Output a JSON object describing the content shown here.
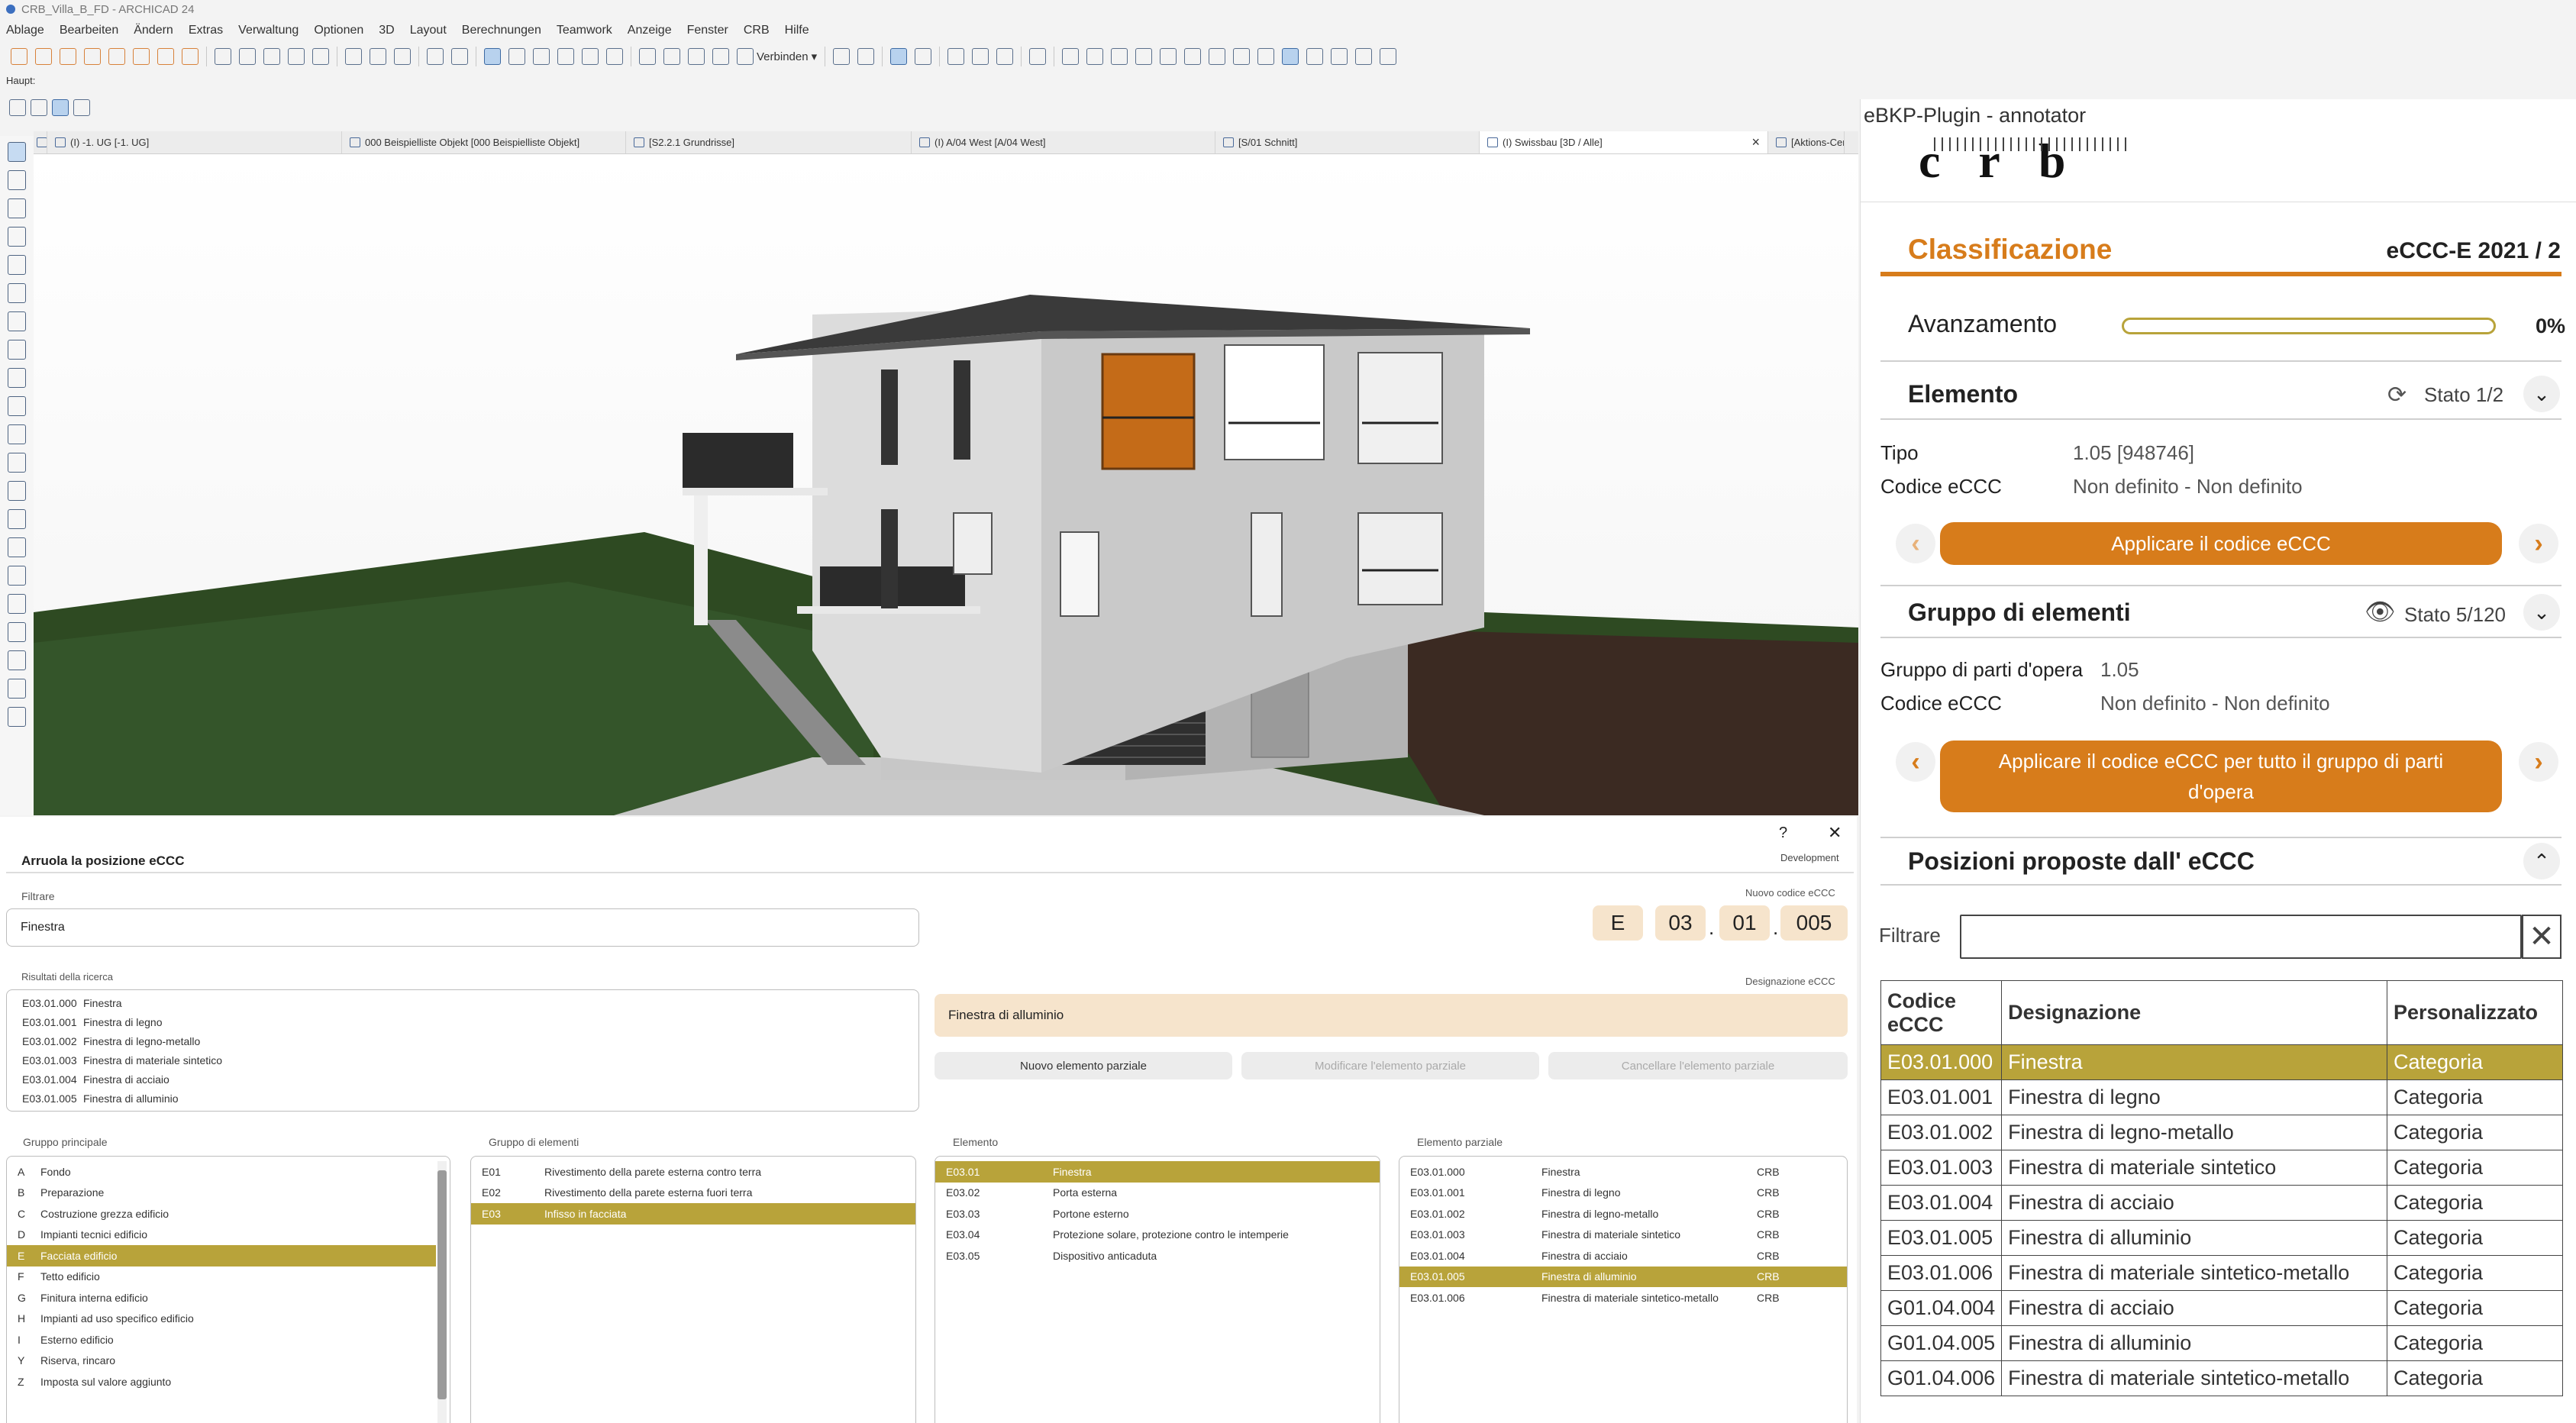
{
  "window": {
    "title": "CRB_Villa_B_FD - ARCHICAD 24"
  },
  "menu": [
    "Ablage",
    "Bearbeiten",
    "Ändern",
    "Extras",
    "Verwaltung",
    "Optionen",
    "3D",
    "Layout",
    "Berechnungen",
    "Teamwork",
    "Anzeige",
    "Fenster",
    "CRB",
    "Hilfe"
  ],
  "toolbar": {
    "connect_label": "Verbinden",
    "haupt_label": "Haupt:"
  },
  "tabs": [
    {
      "label": "(I) -1. UG [-1. UG]"
    },
    {
      "label": "000 Beispielliste Objekt [000 Beispielliste Objekt]"
    },
    {
      "label": "[S2.2.1 Grundrisse]"
    },
    {
      "label": "(I) A/04 West [A/04 West]"
    },
    {
      "label": "[S/01 Schnitt]"
    },
    {
      "label": "(I) Swissbau [3D / Alle]"
    },
    {
      "label": "[Aktions-Cen"
    }
  ],
  "colors": {
    "accent": "#d77c1b",
    "selection": "#b8a33a"
  },
  "position_panel": {
    "title": "Arruola la posizione eCCC",
    "help": "?",
    "close": "✕",
    "development": "Development",
    "filter_label": "Filtrare",
    "filter_value": "Finestra",
    "new_code_label": "Nuovo codice eCCC",
    "code_parts": [
      "E",
      "03",
      "01",
      "005"
    ],
    "code_dot": ".",
    "results_label": "Risultati della ricerca",
    "results": [
      {
        "code": "E03.01.000",
        "name": "Finestra"
      },
      {
        "code": "E03.01.001",
        "name": "Finestra di legno"
      },
      {
        "code": "E03.01.002",
        "name": "Finestra di legno-metallo"
      },
      {
        "code": "E03.01.003",
        "name": "Finestra di materiale sintetico"
      },
      {
        "code": "E03.01.004",
        "name": "Finestra di acciaio"
      },
      {
        "code": "E03.01.005",
        "name": "Finestra di alluminio"
      }
    ],
    "designation_label": "Designazione eCCC",
    "designation_value": "Finestra di alluminio",
    "buttons": {
      "new": "Nuovo elemento parziale",
      "modify": "Modificare l'elemento parziale",
      "delete": "Cancellare l'elemento parziale"
    },
    "main_group_label": "Gruppo principale",
    "main_groups": [
      {
        "code": "A",
        "name": "Fondo"
      },
      {
        "code": "B",
        "name": "Preparazione"
      },
      {
        "code": "C",
        "name": "Costruzione grezza edificio"
      },
      {
        "code": "D",
        "name": "Impianti tecnici edificio"
      },
      {
        "code": "E",
        "name": "Facciata edificio",
        "selected": true
      },
      {
        "code": "F",
        "name": "Tetto edificio"
      },
      {
        "code": "G",
        "name": "Finitura interna edificio"
      },
      {
        "code": "H",
        "name": "Impianti ad uso specifico edificio"
      },
      {
        "code": "I",
        "name": "Esterno edificio"
      },
      {
        "code": "Y",
        "name": "Riserva, rincaro"
      },
      {
        "code": "Z",
        "name": "Imposta sul valore aggiunto"
      }
    ],
    "element_group_label": "Gruppo di elementi",
    "element_groups": [
      {
        "code": "E01",
        "name": "Rivestimento della parete esterna contro terra"
      },
      {
        "code": "E02",
        "name": "Rivestimento della parete esterna fuori terra"
      },
      {
        "code": "E03",
        "name": "Infisso in facciata",
        "selected": true
      }
    ],
    "element_label": "Elemento",
    "elements": [
      {
        "code": "E03.01",
        "name": "Finestra",
        "selected": true
      },
      {
        "code": "E03.02",
        "name": "Porta esterna"
      },
      {
        "code": "E03.03",
        "name": "Portone esterno"
      },
      {
        "code": "E03.04",
        "name": "Protezione solare, protezione contro le intemperie"
      },
      {
        "code": "E03.05",
        "name": "Dispositivo anticaduta"
      }
    ],
    "partial_label": "Elemento parziale",
    "partials": [
      {
        "code": "E03.01.000",
        "name": "Finestra",
        "src": "CRB"
      },
      {
        "code": "E03.01.001",
        "name": "Finestra di legno",
        "src": "CRB"
      },
      {
        "code": "E03.01.002",
        "name": "Finestra di legno-metallo",
        "src": "CRB"
      },
      {
        "code": "E03.01.003",
        "name": "Finestra di materiale sintetico",
        "src": "CRB"
      },
      {
        "code": "E03.01.004",
        "name": "Finestra di acciaio",
        "src": "CRB"
      },
      {
        "code": "E03.01.005",
        "name": "Finestra di alluminio",
        "src": "CRB",
        "selected": true
      },
      {
        "code": "E03.01.006",
        "name": "Finestra di materiale sintetico-metallo",
        "src": "CRB"
      }
    ]
  },
  "plugin": {
    "title": "eBKP-Plugin - annotator",
    "logo": "crb",
    "classification_title": "Classificazione",
    "version": "eCCC-E 2021 / 2",
    "progress_label": "Avanzamento",
    "progress_value": "0%",
    "progress_fraction": 0,
    "element_title": "Elemento",
    "element_state": "Stato 1/2",
    "tipo_label": "Tipo",
    "tipo_value": "1.05 [948746]",
    "code_label": "Codice eCCC",
    "code_value": "Non definito - Non definito",
    "apply_btn": "Applicare il codice eCCC",
    "group_title": "Gruppo di elementi",
    "group_state": "Stato 5/120",
    "group_parts_label": "Gruppo di parti d'opera",
    "group_parts_value": "1.05",
    "group_code_label": "Codice eCCC",
    "group_code_value": "Non definito - Non definito",
    "apply_group_btn": "Applicare il codice eCCC per tutto il gruppo di parti d'opera",
    "proposed_title": "Posizioni proposte dall' eCCC",
    "filter_label": "Filtrare",
    "filter_value": "",
    "table_headers": [
      "Codice eCCC",
      "Designazione",
      "Personalizzato"
    ],
    "table_rows": [
      {
        "code": "E03.01.000",
        "name": "Finestra",
        "type": "Categoria",
        "selected": true
      },
      {
        "code": "E03.01.001",
        "name": "Finestra di legno",
        "type": "Categoria"
      },
      {
        "code": "E03.01.002",
        "name": "Finestra di legno-metallo",
        "type": "Categoria"
      },
      {
        "code": "E03.01.003",
        "name": "Finestra di materiale sintetico",
        "type": "Categoria"
      },
      {
        "code": "E03.01.004",
        "name": "Finestra di acciaio",
        "type": "Categoria"
      },
      {
        "code": "E03.01.005",
        "name": "Finestra di alluminio",
        "type": "Categoria"
      },
      {
        "code": "E03.01.006",
        "name": "Finestra di materiale sintetico-metallo",
        "type": "Categoria"
      },
      {
        "code": "G01.04.004",
        "name": "Finestra di acciaio",
        "type": "Categoria"
      },
      {
        "code": "G01.04.005",
        "name": "Finestra di alluminio",
        "type": "Categoria"
      },
      {
        "code": "G01.04.006",
        "name": "Finestra di materiale sintetico-metallo",
        "type": "Categoria"
      }
    ]
  }
}
